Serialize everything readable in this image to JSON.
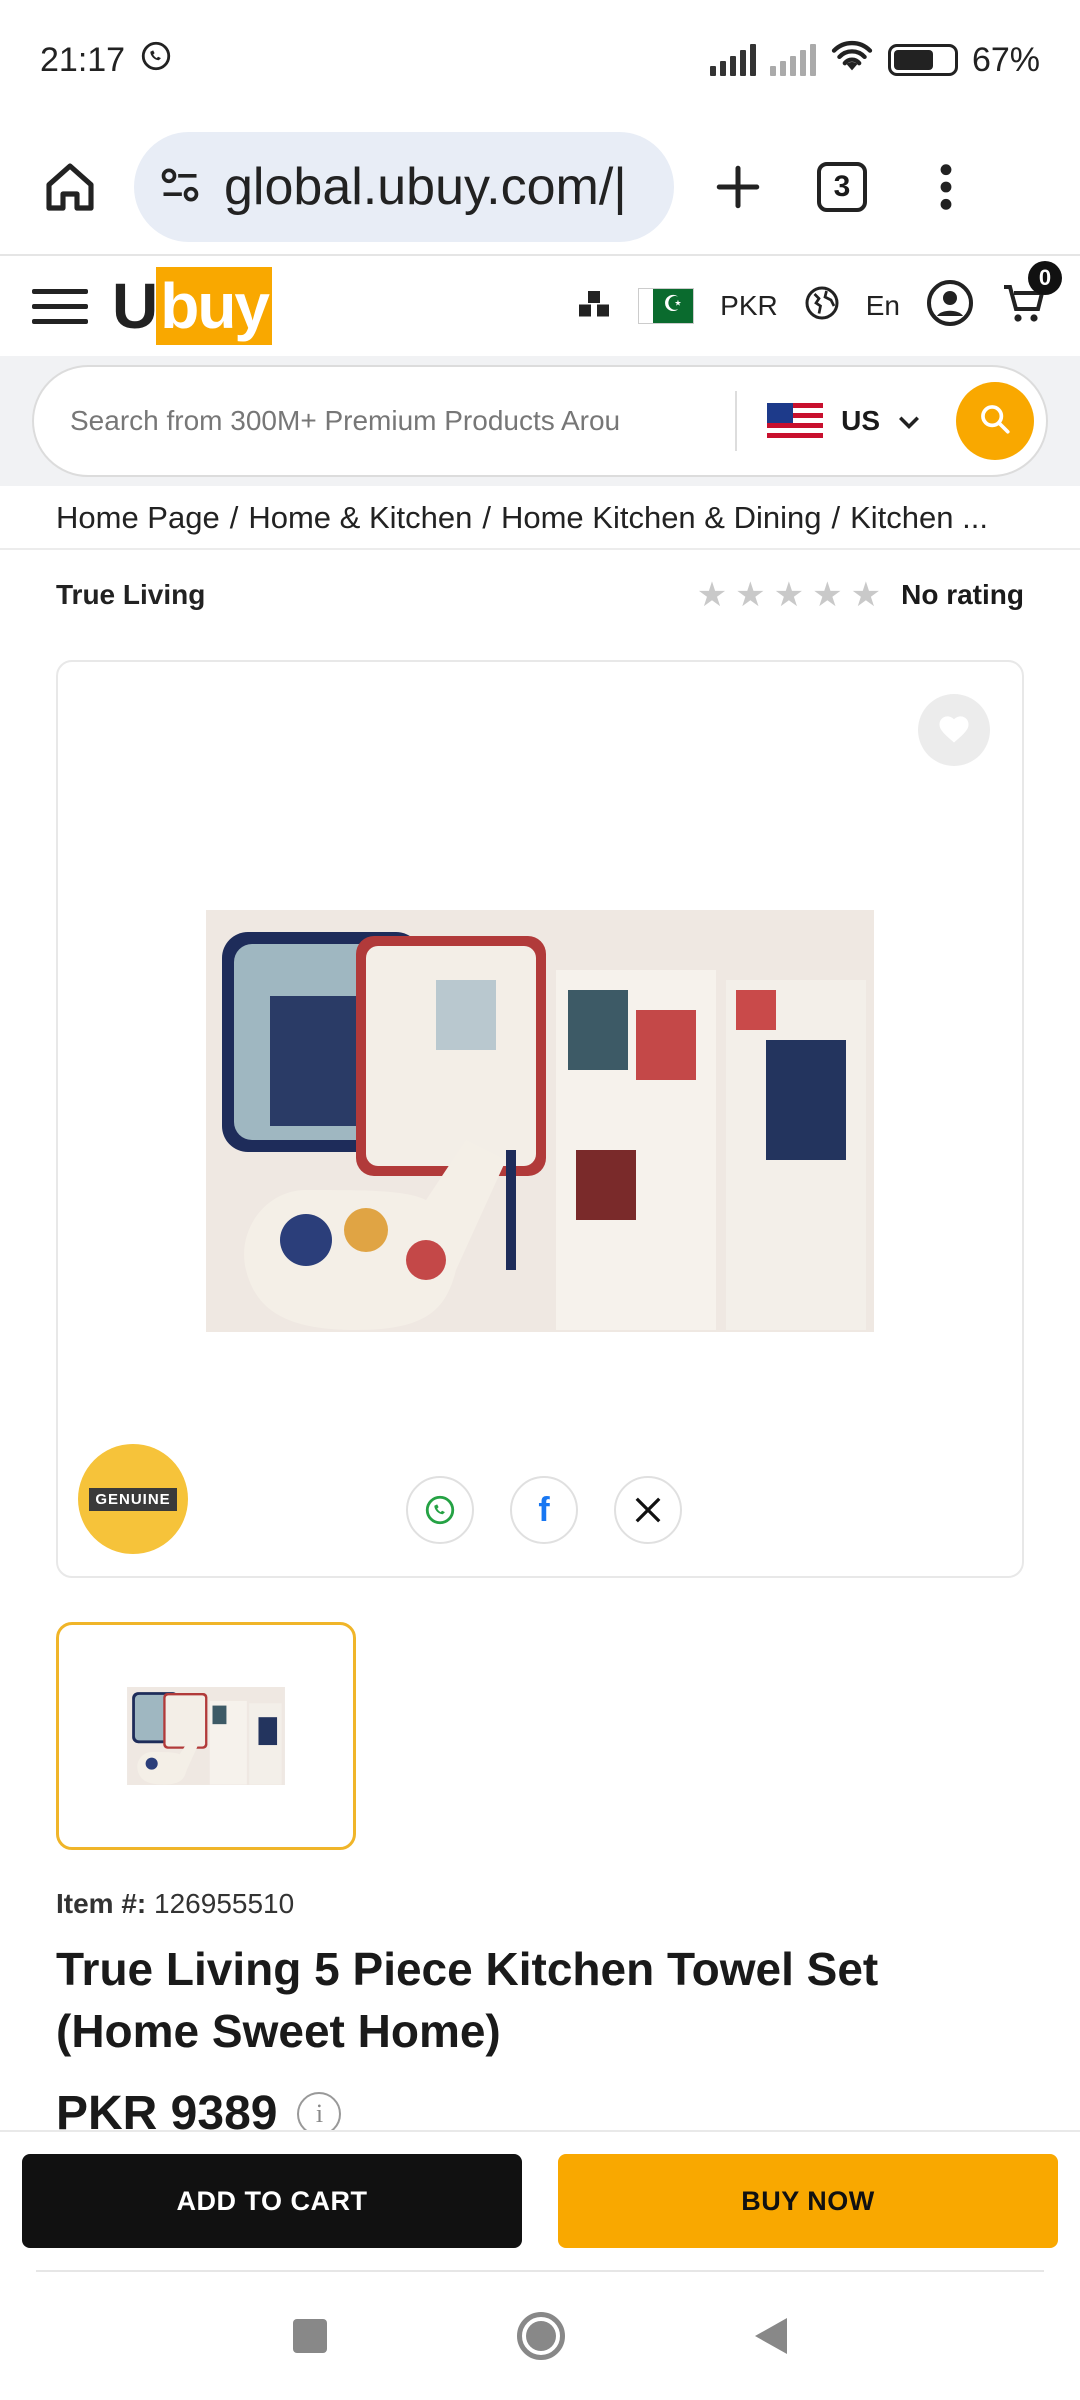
{
  "status": {
    "time": "21:17",
    "battery": "67%"
  },
  "browser": {
    "url": "global.ubuy.com/|",
    "tab_count": "3"
  },
  "header": {
    "logo_u": "U",
    "logo_buy": "buy",
    "currency": "PKR",
    "language": "En",
    "cart_count": "0"
  },
  "search": {
    "placeholder": "Search from 300M+ Premium Products Arou",
    "country": "US"
  },
  "breadcrumb": [
    "Home Page",
    "Home & Kitchen",
    "Home Kitchen & Dining",
    "Kitchen ..."
  ],
  "product": {
    "brand": "True Living",
    "rating_text": "No rating",
    "genuine_label": "GENUINE",
    "item_label": "Item #:",
    "item_number": "126955510",
    "title": "True Living 5 Piece Kitchen Towel Set (Home Sweet Home)",
    "price": "PKR 9389"
  },
  "actions": {
    "add_to_cart": "ADD TO CART",
    "buy_now": "BUY NOW"
  },
  "colors": {
    "accent": "#f9a800",
    "dark": "#111111"
  }
}
